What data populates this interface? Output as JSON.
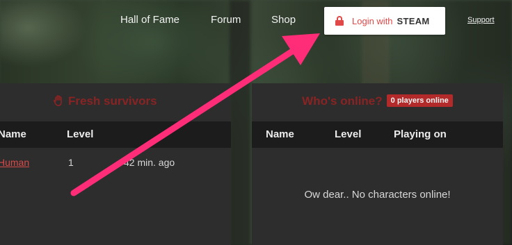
{
  "nav": {
    "items": [
      {
        "label": "Hall of Fame"
      },
      {
        "label": "Forum"
      },
      {
        "label": "Shop"
      }
    ],
    "login": {
      "prefix": "Login with",
      "brand": "STEAM"
    },
    "support_label": "Support"
  },
  "fresh_survivors": {
    "title": "Fresh survivors",
    "columns": [
      "Name",
      "Level"
    ],
    "rows": [
      {
        "name": "Human",
        "level": "1",
        "time": "42 min. ago"
      }
    ]
  },
  "whos_online": {
    "title": "Who's online?",
    "badge": "0 players online",
    "columns": [
      "Name",
      "Level",
      "Playing on"
    ],
    "empty_message": "Ow dear.. No characters online!"
  },
  "colors": {
    "accent_red": "#e14848",
    "title_red": "#8a2323",
    "badge_red": "#b32a2a",
    "annotation_pink": "#ff2d78"
  },
  "icons": {
    "lock": "lock-icon",
    "survivor": "raised-hand-icon",
    "annotation": "arrow-annotation"
  }
}
